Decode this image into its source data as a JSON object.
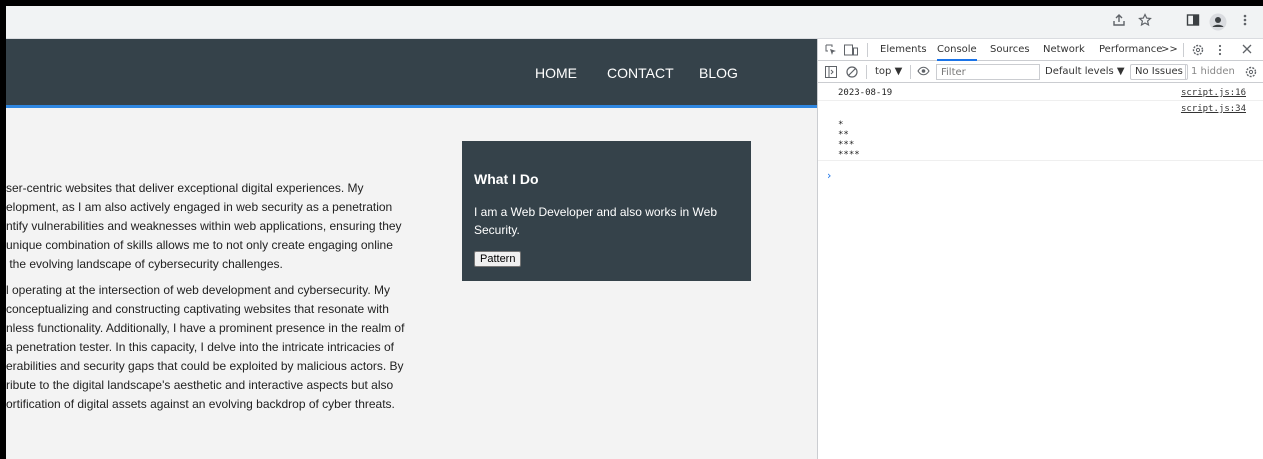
{
  "browser": {
    "icons": [
      "share-icon",
      "star-icon",
      "sidebar-icon",
      "profile-icon",
      "menu-icon"
    ]
  },
  "page": {
    "nav": [
      "HOME",
      "CONTACT",
      "BLOG"
    ],
    "paragraph1": [
      "ser-centric websites that deliver exceptional digital experiences. My",
      "elopment, as I am also actively engaged in web security as a penetration",
      "ntify vulnerabilities and weaknesses within web applications, ensuring they",
      "unique combination of skills allows me to not only create engaging online",
      " the evolving landscape of cybersecurity challenges."
    ],
    "paragraph2": [
      "l operating at the intersection of web development and cybersecurity. My",
      "conceptualizing and constructing captivating websites that resonate with",
      "nless functionality. Additionally, I have a prominent presence in the realm of",
      "a penetration tester. In this capacity, I delve into the intricate intricacies of",
      "erabilities and security gaps that could be exploited by malicious actors. By",
      "ribute to the digital landscape's aesthetic and interactive aspects but also",
      "ortification of digital assets against an evolving backdrop of cyber threats."
    ],
    "card": {
      "title": "What I Do",
      "text": "I am a Web Developer and also works in Web Security.",
      "button": "Pattern"
    }
  },
  "devtools": {
    "tabs": [
      "Elements",
      "Console",
      "Sources",
      "Network",
      "Performance"
    ],
    "active_tab": "Console",
    "more": ">>",
    "context": "top ▼",
    "filter_placeholder": "Filter",
    "levels": "Default levels ▼",
    "issues": "No Issues",
    "hidden": "1 hidden",
    "logs": [
      {
        "msg": "2023-08-19",
        "src": "script.js:16"
      },
      {
        "msg": "\n*\n**\n***\n****",
        "src": "script.js:34"
      }
    ],
    "prompt": "›"
  }
}
